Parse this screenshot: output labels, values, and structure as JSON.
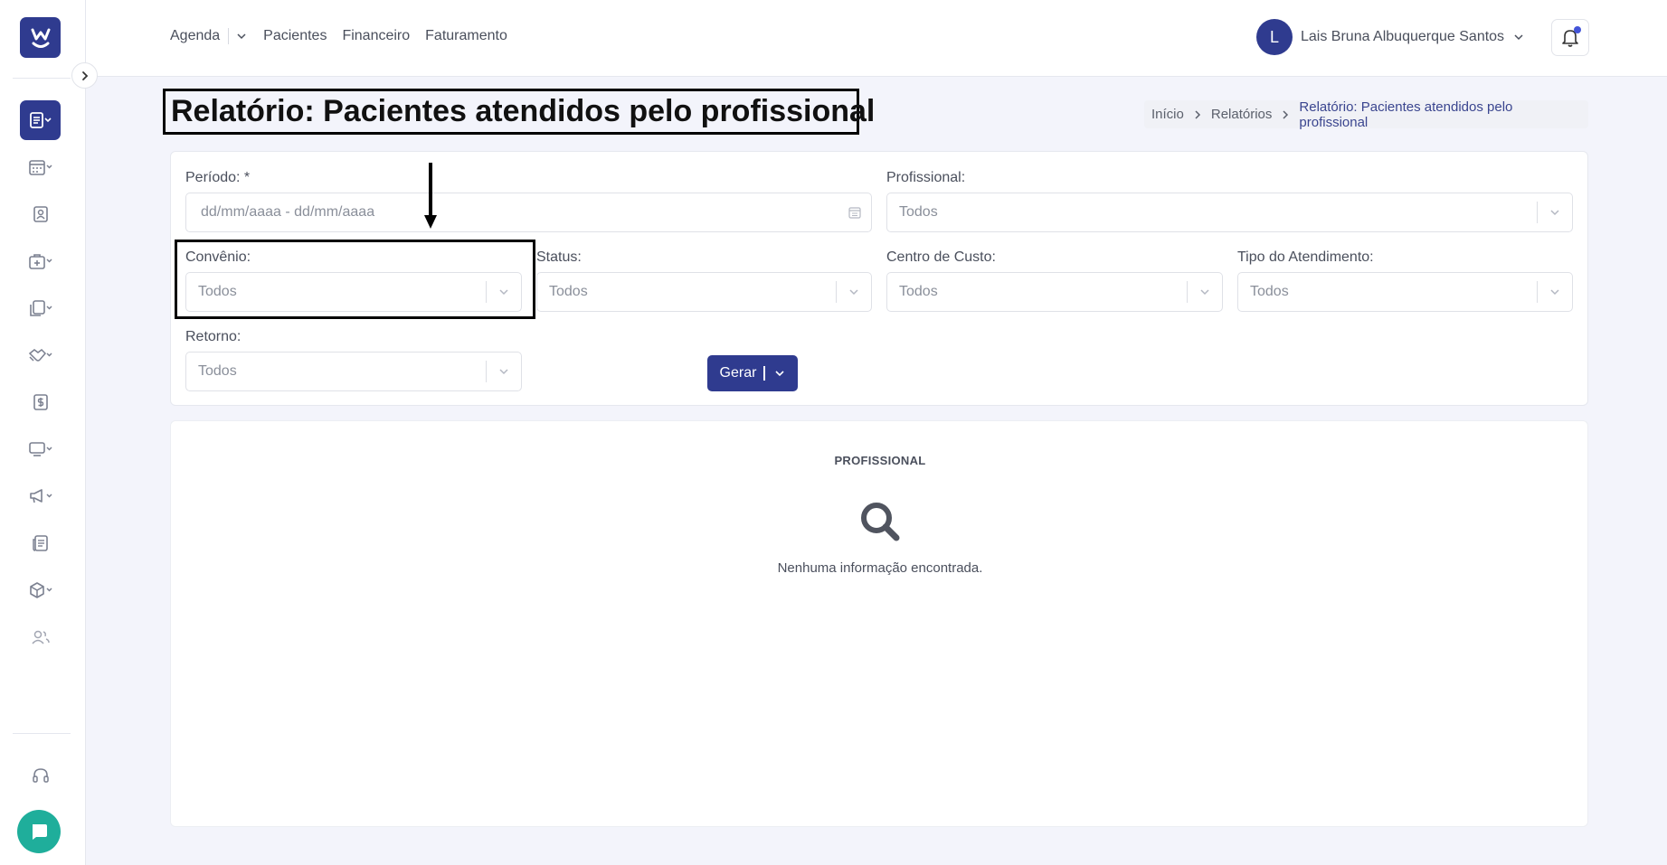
{
  "nav": {
    "agenda": "Agenda",
    "pacientes": "Pacientes",
    "financeiro": "Financeiro",
    "faturamento": "Faturamento"
  },
  "user": {
    "initial": "L",
    "name": "Lais Bruna Albuquerque Santos"
  },
  "page": {
    "title": "Relatório: Pacientes atendidos pelo profissional"
  },
  "breadcrumb": {
    "items": [
      "Início",
      "Relatórios",
      "Relatório: Pacientes atendidos pelo profissional"
    ]
  },
  "filters": {
    "periodo": {
      "label": "Período: *",
      "placeholder": "dd/mm/aaaa - dd/mm/aaaa"
    },
    "profissional": {
      "label": "Profissional:",
      "value": "Todos"
    },
    "convenio": {
      "label": "Convênio:",
      "value": "Todos"
    },
    "status": {
      "label": "Status:",
      "value": "Todos"
    },
    "centro_custo": {
      "label": "Centro de Custo:",
      "value": "Todos"
    },
    "tipo_atendimento": {
      "label": "Tipo do Atendimento:",
      "value": "Todos"
    },
    "retorno": {
      "label": "Retorno:",
      "value": "Todos"
    },
    "gerar_label": "Gerar"
  },
  "results": {
    "header": "PROFISSIONAL",
    "empty_message": "Nenhuma informação encontrada."
  },
  "colors": {
    "primary": "#2f3b8f",
    "chat": "#1fae9b",
    "notification_dot": "#4354d8"
  },
  "icons": {
    "sidebar": [
      "report-icon",
      "calendar-icon",
      "patient-card-icon",
      "medical-kit-icon",
      "documents-icon",
      "handshake-icon",
      "dollar-icon",
      "monitor-icon",
      "megaphone-icon",
      "newspaper-icon",
      "box-icon",
      "users-icon",
      "headset-icon"
    ]
  }
}
